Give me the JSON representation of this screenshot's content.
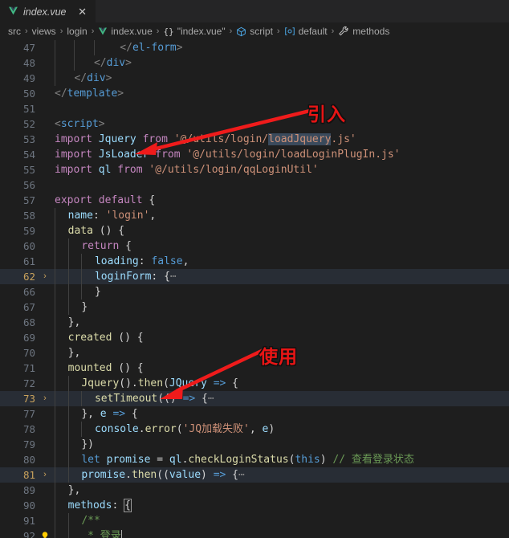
{
  "window": {
    "theme_bg": "#1e1e1e",
    "accent": "#007acc"
  },
  "tab": {
    "label": "index.vue",
    "icon": "vue-logo-icon",
    "close_label": "✕"
  },
  "breadcrumb": {
    "items": [
      {
        "label": "src",
        "icon": ""
      },
      {
        "label": "views",
        "icon": ""
      },
      {
        "label": "login",
        "icon": ""
      },
      {
        "label": "index.vue",
        "icon": "vue-logo-icon"
      },
      {
        "label": "\"index.vue\"",
        "icon": "braces-icon"
      },
      {
        "label": "script",
        "icon": "cube-icon"
      },
      {
        "label": "default",
        "icon": "object-icon"
      },
      {
        "label": "methods",
        "icon": "wrench-icon"
      }
    ],
    "separator": "›"
  },
  "editor": {
    "language": "vue",
    "lines": [
      {
        "num": "47",
        "state": "normal"
      },
      {
        "num": "48",
        "state": "normal"
      },
      {
        "num": "49",
        "state": "normal"
      },
      {
        "num": "50",
        "state": "normal"
      },
      {
        "num": "51",
        "state": "normal"
      },
      {
        "num": "52",
        "state": "normal"
      },
      {
        "num": "53",
        "state": "normal"
      },
      {
        "num": "54",
        "state": "normal"
      },
      {
        "num": "55",
        "state": "normal"
      },
      {
        "num": "56",
        "state": "normal"
      },
      {
        "num": "57",
        "state": "normal"
      },
      {
        "num": "58",
        "state": "normal"
      },
      {
        "num": "59",
        "state": "normal"
      },
      {
        "num": "60",
        "state": "normal"
      },
      {
        "num": "61",
        "state": "normal"
      },
      {
        "num": "62",
        "state": "folded-highlight"
      },
      {
        "num": "66",
        "state": "normal"
      },
      {
        "num": "67",
        "state": "normal"
      },
      {
        "num": "68",
        "state": "normal"
      },
      {
        "num": "69",
        "state": "normal"
      },
      {
        "num": "70",
        "state": "normal"
      },
      {
        "num": "71",
        "state": "normal"
      },
      {
        "num": "72",
        "state": "normal"
      },
      {
        "num": "73",
        "state": "folded-highlight"
      },
      {
        "num": "77",
        "state": "normal"
      },
      {
        "num": "78",
        "state": "normal"
      },
      {
        "num": "79",
        "state": "normal"
      },
      {
        "num": "80",
        "state": "normal"
      },
      {
        "num": "81",
        "state": "folded-highlight"
      },
      {
        "num": "89",
        "state": "normal"
      },
      {
        "num": "90",
        "state": "normal"
      },
      {
        "num": "91",
        "state": "normal"
      },
      {
        "num": "92",
        "state": "lightbulb"
      }
    ],
    "text": {
      "l47": "        </el-form>",
      "l48": "      </div>",
      "l49": "    </div>",
      "l50": "  </template>",
      "l51": "",
      "l52": "  <script>",
      "l53": "  import Jquery from '@/utils/login/loadJquery.js'",
      "l54": "  import JsLoader from '@/utils/login/loadLoginPlugIn.js'",
      "l55": "  import ql from '@/utils/login/qqLoginUtil'",
      "l56": "",
      "l57": "  export default {",
      "l58": "    name: 'login',",
      "l59": "    data () {",
      "l60": "      return {",
      "l61": "        loading: false,",
      "l62": "        loginForm: {⋯",
      "l66": "        }",
      "l67": "      }",
      "l68": "    },",
      "l69": "    created () {",
      "l70": "    },",
      "l71": "    mounted () {",
      "l72": "      Jquery().then(JQuery => {",
      "l73": "        setTimeout(() => {⋯",
      "l77": "      }, e => {",
      "l78": "        console.error('JQ加载失败', e)",
      "l79": "      })",
      "l80": "      let promise = ql.checkLoginStatus(this) // 查看登录状态",
      "l81": "      promise.then((value) => {⋯",
      "l89": "    },",
      "l90": "    methods: {",
      "l91": "      /**",
      "l92": "       * 登录"
    },
    "selection_token": "loadJquery",
    "fold_ellipsis": "⋯",
    "fold_chevron": "›",
    "lightbulb_icon": "lightbulb-icon"
  },
  "annotations": [
    {
      "id": "anno-import",
      "text": "引入",
      "color": "#e81515"
    },
    {
      "id": "anno-usage",
      "text": "使用",
      "color": "#e81515"
    }
  ]
}
